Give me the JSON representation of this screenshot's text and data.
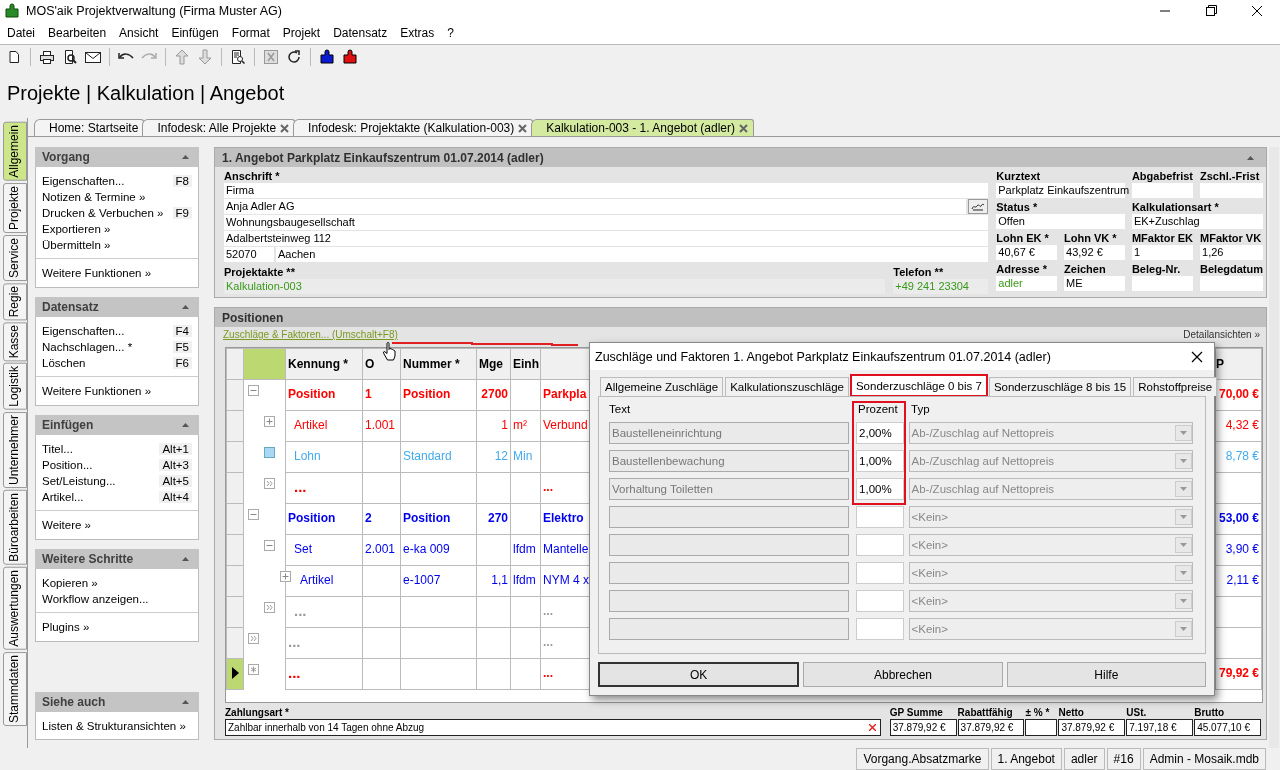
{
  "window": {
    "title": "MOS'aik Projektverwaltung (Firma Muster AG)"
  },
  "menu": [
    "Datei",
    "Bearbeiten",
    "Ansicht",
    "Einfügen",
    "Format",
    "Projekt",
    "Datensatz",
    "Extras",
    "?"
  ],
  "breadcrumb": "Projekte | Kalkulation | Angebot",
  "doc_tabs": [
    {
      "label": "Home: Startseite",
      "selected": false,
      "closable": false
    },
    {
      "label": "Infodesk: Alle Projekte",
      "selected": false,
      "closable": true
    },
    {
      "label": "Infodesk: Projektakte (Kalkulation-003)",
      "selected": false,
      "closable": true
    },
    {
      "label": "Kalkulation-003 - 1. Angebot (adler)",
      "selected": true,
      "closable": true
    }
  ],
  "side_tabs": [
    {
      "label": "Allgemein",
      "selected": true
    },
    {
      "label": "Projekte",
      "selected": false
    },
    {
      "label": "Service",
      "selected": false
    },
    {
      "label": "Regie",
      "selected": false
    },
    {
      "label": "Kasse",
      "selected": false
    },
    {
      "label": "Logistik",
      "selected": false
    },
    {
      "label": "Unternehmer",
      "selected": false
    },
    {
      "label": "Büroarbeiten",
      "selected": false
    },
    {
      "label": "Auswertungen",
      "selected": false
    },
    {
      "label": "Stammdaten",
      "selected": false
    }
  ],
  "task_panels": [
    {
      "title": "Vorgang",
      "items": [
        {
          "label": "Eigenschaften...",
          "shortcut": "F8"
        },
        {
          "label": "Notizen & Termine »"
        },
        {
          "label": "Drucken & Verbuchen »",
          "shortcut": "F9"
        },
        {
          "label": "Exportieren »"
        },
        {
          "label": "Übermitteln »"
        }
      ],
      "footer": [
        "Weitere Funktionen »"
      ]
    },
    {
      "title": "Datensatz",
      "items": [
        {
          "label": "Eigenschaften...",
          "shortcut": "F4"
        },
        {
          "label": "Nachschlagen... *",
          "shortcut": "F5"
        },
        {
          "label": "Löschen",
          "shortcut": "F6"
        }
      ],
      "footer": [
        "Weitere Funktionen »"
      ]
    },
    {
      "title": "Einfügen",
      "items": [
        {
          "label": "Titel...",
          "shortcut": "Alt+1"
        },
        {
          "label": "Position...",
          "shortcut": "Alt+3"
        },
        {
          "label": "Set/Leistung...",
          "shortcut": "Alt+5"
        },
        {
          "label": "Artikel...",
          "shortcut": "Alt+4"
        }
      ],
      "footer": [
        "Weitere »"
      ]
    },
    {
      "title": "Weitere Schritte",
      "items": [
        {
          "label": "Kopieren »"
        },
        {
          "label": "Workflow anzeigen..."
        }
      ],
      "footer": [
        "Plugins »"
      ]
    },
    {
      "title": "Siehe auch",
      "items": [
        {
          "label": "Listen & Strukturansichten »"
        }
      ]
    }
  ],
  "offer": {
    "title": "1. Angebot Parkplatz Einkaufszentrum 01.07.2014 (adler)",
    "address": {
      "label": "Anschrift *",
      "lines": [
        "Firma",
        "Anja Adler AG",
        "Wohnungsbaugesellschaft",
        "Adalbertsteinweg 112"
      ],
      "zip": "52070",
      "city": "Aachen"
    },
    "project_file": {
      "label": "Projektakte **",
      "value": "Kalkulation-003",
      "link": true
    },
    "phone": {
      "label": "Telefon **",
      "value": "+49 241 23304",
      "link": true
    },
    "field_rows": [
      [
        {
          "label": "Kurztext",
          "value": "Parkplatz Einkaufszentrum",
          "link": false
        },
        {
          "label": "Abgabefrist"
        },
        {
          "label": "Zschl.-Frist"
        }
      ],
      [
        {
          "label": "Status *",
          "value": "Offen",
          "link": false
        },
        {
          "label": "Kalkulationsart *",
          "value": "EK+Zuschlag",
          "link": false
        }
      ],
      [
        {
          "label": "Lohn EK *",
          "value": "40,67 €",
          "link": false
        },
        {
          "label": "Lohn VK *",
          "value": "43,92 €",
          "link": false
        },
        {
          "label": "MFaktor EK",
          "value": "1",
          "link": false
        },
        {
          "label": "MFaktor VK",
          "value": "1,26",
          "link": false
        }
      ],
      [
        {
          "label": "Adresse *",
          "value": "adler",
          "link": true
        },
        {
          "label": "Zeichen",
          "value": "ME",
          "link": false
        },
        {
          "label": "Beleg-Nr."
        },
        {
          "label": "Belegdatum"
        }
      ]
    ]
  },
  "positions": {
    "title": "Positionen",
    "action_link": "Zuschläge & Faktoren... (Umschalt+F8)",
    "details_link": "Detailansichten »",
    "columns": [
      "Kennung *",
      "O",
      "Nummer *",
      "Mge",
      "Einh",
      "P"
    ],
    "rows": [
      {
        "kind": "position",
        "current": false,
        "expanded": true,
        "color": "#ff0000",
        "kennung": "Position",
        "oz": "1",
        "nummer": "Position",
        "mge": "2700",
        "text": "Parkpla",
        "gp": "70,00 €",
        "children": [
          {
            "kind": "article",
            "current": false,
            "expanded": false,
            "color": "#ff0000",
            "kennung": "Artikel",
            "oz": "1.001",
            "mge": "1",
            "einh": "m²",
            "text": "Verbund",
            "gp": "4,32 €"
          },
          {
            "kind": "labor",
            "current": false,
            "color": "#44aaee",
            "kennung": "Lohn",
            "nummer": "Standard",
            "mge": "12",
            "einh": "Min",
            "gp": "8,78 €"
          },
          {
            "kind": "more",
            "current": false,
            "color": "#ff0000",
            "kennung": "...",
            "text": "..."
          }
        ]
      },
      {
        "kind": "position",
        "current": false,
        "expanded": true,
        "color": "#0000ee",
        "kennung": "Position",
        "oz": "2",
        "nummer": "Position",
        "mge": "270",
        "text": "Elektro",
        "gp": "53,00 €",
        "children": [
          {
            "kind": "set",
            "current": false,
            "expanded": true,
            "color": "#0000ee",
            "kennung": "Set",
            "oz": "2.001",
            "nummer": "e-ka 009",
            "einh": "lfdm",
            "text": "Mantelle",
            "gp": "3,90 €",
            "children": [
              {
                "kind": "article",
                "current": false,
                "expanded": false,
                "color": "#0000ee",
                "kennung": "Artikel",
                "nummer": "e-1007",
                "mge": "1,1",
                "einh": "lfdm",
                "text": "NYM 4 x",
                "gp": "2,11 €"
              }
            ]
          },
          {
            "kind": "more",
            "current": false,
            "color": "#999999",
            "kennung": "...",
            "text": "..."
          }
        ]
      },
      {
        "kind": "more",
        "current": false,
        "color": "#999999",
        "kennung": "...",
        "text": "..."
      },
      {
        "kind": "new",
        "current": true,
        "color": "#ff0000",
        "kennung": "...",
        "text": "...",
        "gp": "79,92 €"
      }
    ],
    "payment": {
      "label": "Zahlungsart *",
      "value": "Zahlbar innerhalb von 14 Tagen ohne Abzug"
    },
    "totals": [
      {
        "label": "GP Summe",
        "value": "37.879,92 €"
      },
      {
        "label": "Rabattfähig",
        "value": "37.879,92 €"
      },
      {
        "label": "± % *"
      },
      {
        "label": "Netto",
        "value": "37.879,92 €"
      },
      {
        "label": "USt.",
        "value": "7.197,18 €"
      },
      {
        "label": "Brutto",
        "value": "45.077,10 €"
      }
    ]
  },
  "dialog": {
    "title": "Zuschläge und Faktoren 1. Angebot Parkplatz Einkaufszentrum 01.07.2014 (adler)",
    "tabs": [
      {
        "label": "Allgemeine Zuschläge",
        "selected": false
      },
      {
        "label": "Kalkulationszuschläge",
        "selected": false
      },
      {
        "label": "Sonderzuschläge 0 bis 7",
        "selected": true
      },
      {
        "label": "Sonderzuschläge 8 bis 15",
        "selected": false
      },
      {
        "label": "Rohstoffpreise",
        "selected": false
      }
    ],
    "columns": [
      "Text",
      "Prozent",
      "Typ"
    ],
    "rows": [
      {
        "text": "Baustelleneinrichtung",
        "percent": "2,00%",
        "type": "Ab-/Zuschlag auf Nettopreis",
        "highlighted": true
      },
      {
        "text": "Baustellenbewachung",
        "percent": "1,00%",
        "type": "Ab-/Zuschlag auf Nettopreis",
        "highlighted": true
      },
      {
        "text": "Vorhaltung Toiletten",
        "percent": "1,00%",
        "type": "Ab-/Zuschlag auf Nettopreis",
        "highlighted": true
      },
      {
        "type": "<Kein>",
        "highlighted": false
      },
      {
        "type": "<Kein>",
        "highlighted": false
      },
      {
        "type": "<Kein>",
        "highlighted": false
      },
      {
        "type": "<Kein>",
        "highlighted": false
      },
      {
        "type": "<Kein>",
        "highlighted": false
      }
    ],
    "buttons": [
      {
        "label": "OK",
        "default": true
      },
      {
        "label": "Abbrechen",
        "default": false
      },
      {
        "label": "Hilfe",
        "default": false
      }
    ]
  },
  "status_bar": [
    "Vorgang.Absatzmarke",
    "1. Angebot",
    "adler",
    "#16",
    "Admin - Mosaik.mdb"
  ]
}
